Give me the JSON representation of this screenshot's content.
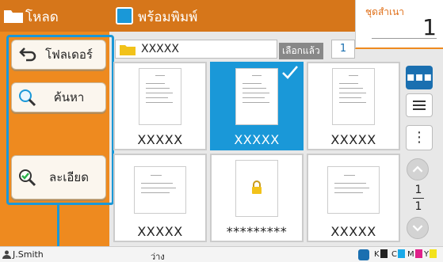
{
  "left_header": {
    "title": "โหลด"
  },
  "side_buttons": {
    "folder": "โฟลเดอร์",
    "search": "ค้นหา",
    "detail": "ละเอียด"
  },
  "main_header": {
    "title": "พร้อมพิมพ์"
  },
  "copies": {
    "label": "ชุดสำเนา",
    "value": "1"
  },
  "folder_bar": {
    "name": "XXXXX",
    "selected_label": "เลือกแล้ว",
    "selected_count": "1"
  },
  "thumbnails": [
    {
      "caption": "XXXXX",
      "selected": false
    },
    {
      "caption": "XXXXX",
      "selected": true
    },
    {
      "caption": "XXXXX",
      "selected": false
    },
    {
      "caption": "XXXXX",
      "selected": false
    },
    {
      "caption": "*********",
      "selected": false,
      "locked": true
    },
    {
      "caption": "XXXXX",
      "selected": false
    }
  ],
  "view_controls": {
    "grid_glyph": "▪▪▪",
    "more_glyph": "⋮"
  },
  "pagination": {
    "current": "1",
    "total": "1"
  },
  "status_bar": {
    "user": "J.Smith",
    "state": "ว่าง",
    "inks": [
      {
        "label": "K",
        "color": "#222222"
      },
      {
        "label": "C",
        "color": "#19a9e8"
      },
      {
        "label": "M",
        "color": "#e0218a"
      },
      {
        "label": "Y",
        "color": "#f3e21b"
      }
    ]
  },
  "colors": {
    "orange": "#ee8a1f",
    "orange_dark": "#d6761a",
    "accent_blue": "#1a98d8"
  }
}
